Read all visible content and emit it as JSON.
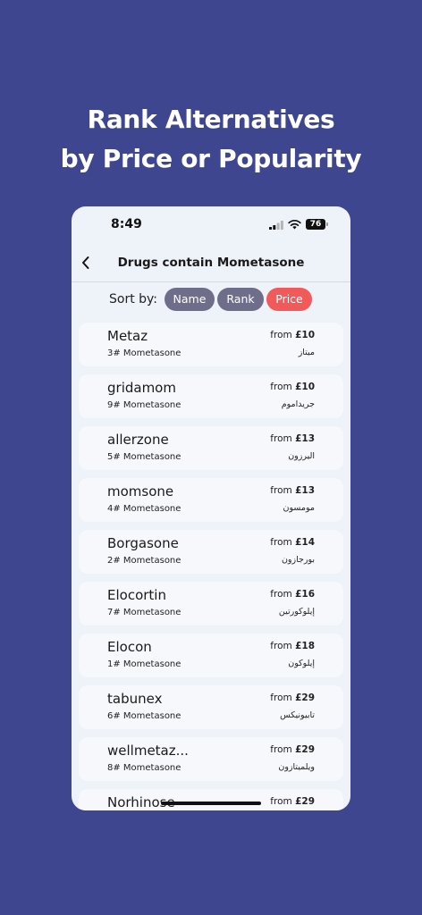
{
  "headline": {
    "line1": "Rank Alternatives",
    "line2": "by Price or Popularity"
  },
  "status_bar": {
    "time": "8:49",
    "battery": "76"
  },
  "nav": {
    "title": "Drugs contain Mometasone"
  },
  "sort": {
    "label": "Sort by:",
    "options": [
      "Name",
      "Rank",
      "Price"
    ],
    "active": "Price"
  },
  "price_prefix": "from",
  "drugs": [
    {
      "name": "Metaz",
      "rank": "3# Mometasone",
      "price": "£10",
      "arabic": "ميتاز"
    },
    {
      "name": "gridamom",
      "rank": "9# Mometasone",
      "price": "£10",
      "arabic": "جريداموم"
    },
    {
      "name": "allerzone",
      "rank": "5# Mometasone",
      "price": "£13",
      "arabic": "اليرزون"
    },
    {
      "name": "momsone",
      "rank": "4# Mometasone",
      "price": "£13",
      "arabic": "مومسون"
    },
    {
      "name": "Borgasone",
      "rank": "2# Mometasone",
      "price": "£14",
      "arabic": "بورجازون"
    },
    {
      "name": "Elocortin",
      "rank": "7# Mometasone",
      "price": "£16",
      "arabic": "إيلوكورتين"
    },
    {
      "name": "Elocon",
      "rank": "1# Mometasone",
      "price": "£18",
      "arabic": "إيلوكون"
    },
    {
      "name": "tabunex",
      "rank": "6# Mometasone",
      "price": "£29",
      "arabic": "تابيونيكس"
    },
    {
      "name": "wellmetaz...",
      "rank": "8# Mometasone",
      "price": "£29",
      "arabic": "ويلميتازون"
    },
    {
      "name": "Norhinose",
      "rank": "",
      "price": "£29",
      "arabic": ""
    }
  ]
}
